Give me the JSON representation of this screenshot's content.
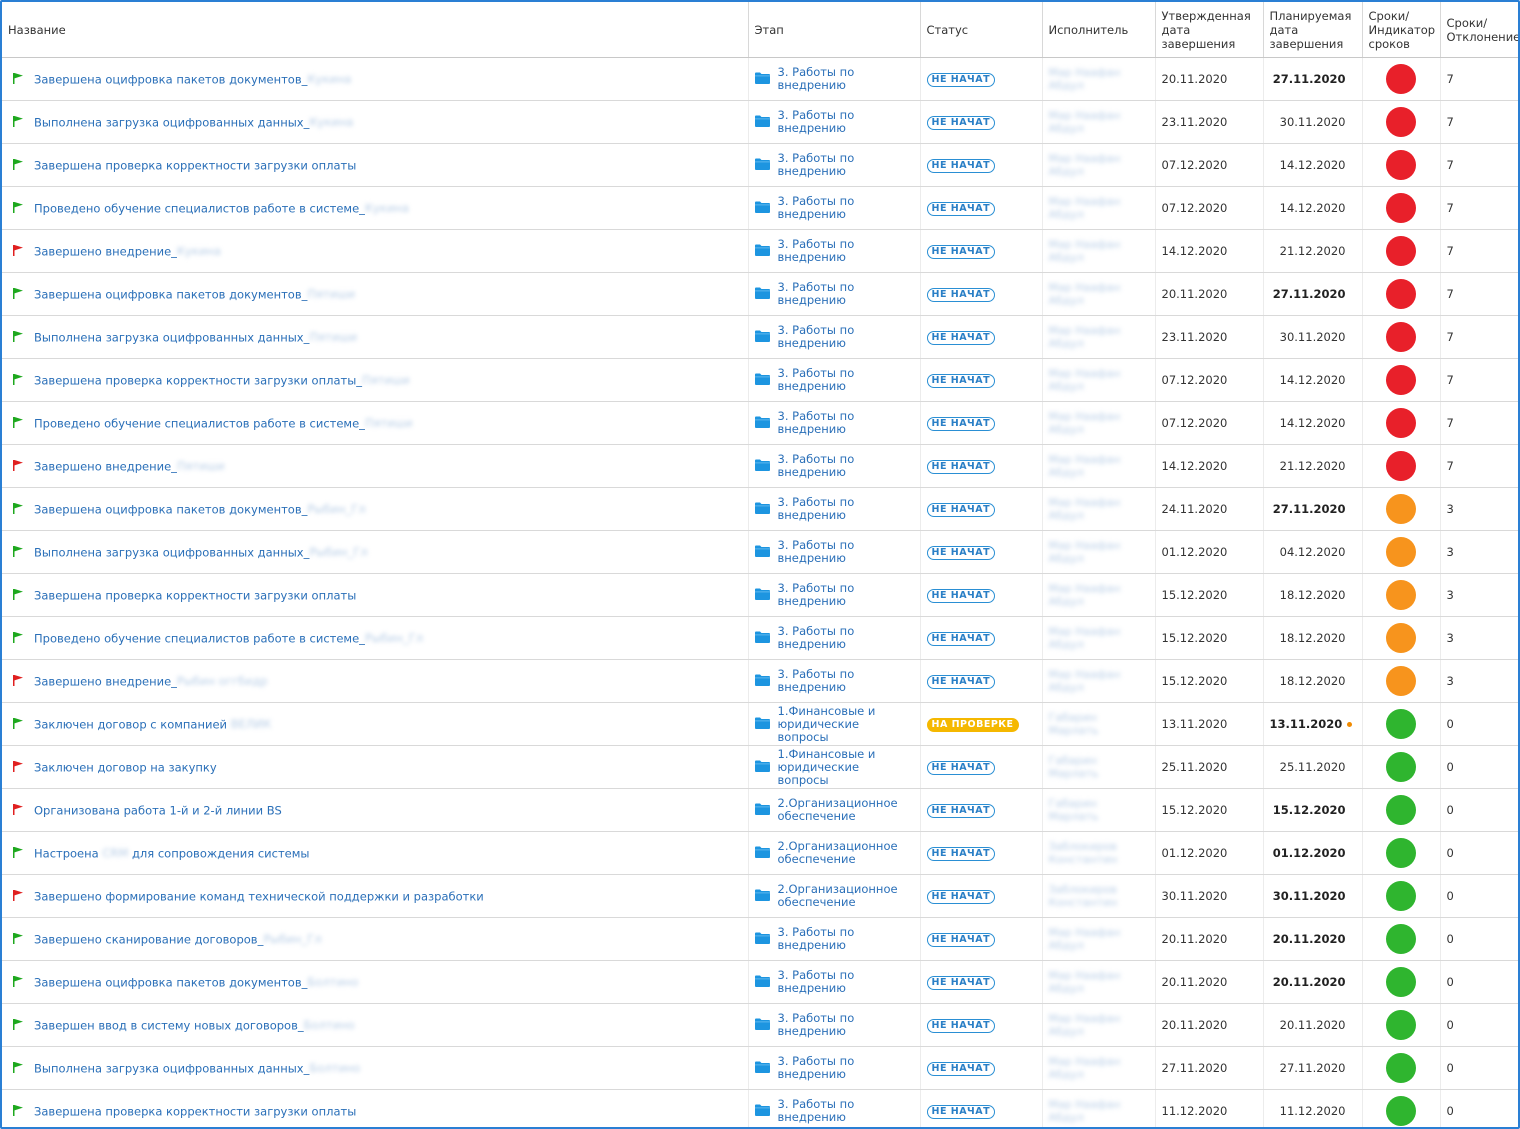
{
  "columns": {
    "name": "Название",
    "stage": "Этап",
    "status": "Статус",
    "executor": "Исполнитель",
    "approved_date": "Утвержденная дата завершения",
    "planned_date": "Планируемая дата завершения",
    "indicator": "Сроки/ Индикатор сроков",
    "deviation": "Сроки/ Отклонение"
  },
  "colors": {
    "red": "#e8202a",
    "orange": "#f7941d",
    "green": "#2fb52f",
    "flag_green": "#1ea81e",
    "flag_red": "#e02020",
    "link": "#2a6fb8",
    "accent": "#2a7fd4"
  },
  "rows": [
    {
      "flag": "green",
      "name": "Завершена оцифровка пакетов документов_",
      "suffix": "Кукина",
      "stage": "3. Работы по внедрению",
      "status": "НЕ НАЧАТ",
      "status_type": "new",
      "executor": "Мар Наафан Абдул",
      "approved": "20.11.2020",
      "planned": "27.11.2020",
      "planned_bold": true,
      "planned_dot": false,
      "indicator": "red",
      "deviation": "7"
    },
    {
      "flag": "green",
      "name": "Выполнена загрузка оцифрованных данных_",
      "suffix": "Кукина",
      "stage": "3. Работы по внедрению",
      "status": "НЕ НАЧАТ",
      "status_type": "new",
      "executor": "Мар Наафан Абдул",
      "approved": "23.11.2020",
      "planned": "30.11.2020",
      "planned_bold": false,
      "planned_dot": false,
      "indicator": "red",
      "deviation": "7"
    },
    {
      "flag": "green",
      "name": "Завершена проверка корректности загрузки оплаты",
      "suffix": "",
      "stage": "3. Работы по внедрению",
      "status": "НЕ НАЧАТ",
      "status_type": "new",
      "executor": "Мар Наафан Абдул",
      "approved": "07.12.2020",
      "planned": "14.12.2020",
      "planned_bold": false,
      "planned_dot": false,
      "indicator": "red",
      "deviation": "7"
    },
    {
      "flag": "green",
      "name": "Проведено обучение специалистов работе в системе_",
      "suffix": "Кукина",
      "stage": "3. Работы по внедрению",
      "status": "НЕ НАЧАТ",
      "status_type": "new",
      "executor": "Мар Наафан Абдул",
      "approved": "07.12.2020",
      "planned": "14.12.2020",
      "planned_bold": false,
      "planned_dot": false,
      "indicator": "red",
      "deviation": "7"
    },
    {
      "flag": "red",
      "name": "Завершено внедрение_",
      "suffix": "Кукина",
      "stage": "3. Работы по внедрению",
      "status": "НЕ НАЧАТ",
      "status_type": "new",
      "executor": "Мар Наафан Абдул",
      "approved": "14.12.2020",
      "planned": "21.12.2020",
      "planned_bold": false,
      "planned_dot": false,
      "indicator": "red",
      "deviation": "7"
    },
    {
      "flag": "green",
      "name": "Завершена оцифровка пакетов документов_",
      "suffix": "Пятиши",
      "stage": "3. Работы по внедрению",
      "status": "НЕ НАЧАТ",
      "status_type": "new",
      "executor": "Мар Наафан Абдул",
      "approved": "20.11.2020",
      "planned": "27.11.2020",
      "planned_bold": true,
      "planned_dot": false,
      "indicator": "red",
      "deviation": "7"
    },
    {
      "flag": "green",
      "name": "Выполнена загрузка оцифрованных данных_",
      "suffix": "Пятиши",
      "stage": "3. Работы по внедрению",
      "status": "НЕ НАЧАТ",
      "status_type": "new",
      "executor": "Мар Наафан Абдул",
      "approved": "23.11.2020",
      "planned": "30.11.2020",
      "planned_bold": false,
      "planned_dot": false,
      "indicator": "red",
      "deviation": "7"
    },
    {
      "flag": "green",
      "name": "Завершена проверка корректности загрузки оплаты_",
      "suffix": "Пятиши",
      "stage": "3. Работы по внедрению",
      "status": "НЕ НАЧАТ",
      "status_type": "new",
      "executor": "Мар Наафан Абдул",
      "approved": "07.12.2020",
      "planned": "14.12.2020",
      "planned_bold": false,
      "planned_dot": false,
      "indicator": "red",
      "deviation": "7"
    },
    {
      "flag": "green",
      "name": "Проведено обучение специалистов работе в системе_",
      "suffix": "Пятиши",
      "stage": "3. Работы по внедрению",
      "status": "НЕ НАЧАТ",
      "status_type": "new",
      "executor": "Мар Наафан Абдул",
      "approved": "07.12.2020",
      "planned": "14.12.2020",
      "planned_bold": false,
      "planned_dot": false,
      "indicator": "red",
      "deviation": "7"
    },
    {
      "flag": "red",
      "name": "Завершено внедрение_",
      "suffix": "Пятиши",
      "stage": "3. Работы по внедрению",
      "status": "НЕ НАЧАТ",
      "status_type": "new",
      "executor": "Мар Наафан Абдул",
      "approved": "14.12.2020",
      "planned": "21.12.2020",
      "planned_bold": false,
      "planned_dot": false,
      "indicator": "red",
      "deviation": "7"
    },
    {
      "flag": "green",
      "name": "Завершена оцифровка пакетов документов_",
      "suffix": "Рыбин_Гл",
      "stage": "3. Работы по внедрению",
      "status": "НЕ НАЧАТ",
      "status_type": "new",
      "executor": "Мар Наафан Абдул",
      "approved": "24.11.2020",
      "planned": "27.11.2020",
      "planned_bold": true,
      "planned_dot": false,
      "indicator": "orange",
      "deviation": "3"
    },
    {
      "flag": "green",
      "name": "Выполнена загрузка оцифрованных данных_",
      "suffix": "Рыбин_Гл",
      "stage": "3. Работы по внедрению",
      "status": "НЕ НАЧАТ",
      "status_type": "new",
      "executor": "Мар Наафан Абдул",
      "approved": "01.12.2020",
      "planned": "04.12.2020",
      "planned_bold": false,
      "planned_dot": false,
      "indicator": "orange",
      "deviation": "3"
    },
    {
      "flag": "green",
      "name": "Завершена проверка корректности загрузки оплаты",
      "suffix": "",
      "stage": "3. Работы по внедрению",
      "status": "НЕ НАЧАТ",
      "status_type": "new",
      "executor": "Мар Наафан Абдул",
      "approved": "15.12.2020",
      "planned": "18.12.2020",
      "planned_bold": false,
      "planned_dot": false,
      "indicator": "orange",
      "deviation": "3"
    },
    {
      "flag": "green",
      "name": "Проведено обучение специалистов работе в системе_",
      "suffix": "Рыбин_Гл",
      "stage": "3. Работы по внедрению",
      "status": "НЕ НАЧАТ",
      "status_type": "new",
      "executor": "Мар Наафан Абдул",
      "approved": "15.12.2020",
      "planned": "18.12.2020",
      "planned_bold": false,
      "planned_dot": false,
      "indicator": "orange",
      "deviation": "3"
    },
    {
      "flag": "red",
      "name": "Завершено внедрение_",
      "suffix": "Рыбин оггбидр",
      "stage": "3. Работы по внедрению",
      "status": "НЕ НАЧАТ",
      "status_type": "new",
      "executor": "Мар Наафан Абдул",
      "approved": "15.12.2020",
      "planned": "18.12.2020",
      "planned_bold": false,
      "planned_dot": false,
      "indicator": "orange",
      "deviation": "3"
    },
    {
      "flag": "green",
      "name": "Заключен договор с компанией ",
      "suffix": "ВЕЛИК",
      "stage": "1.Финансовые и юридические вопросы",
      "status": "НА ПРОВЕРКЕ",
      "status_type": "review",
      "executor": "Габарин Марлать",
      "approved": "13.11.2020",
      "planned": "13.11.2020",
      "planned_bold": true,
      "planned_dot": true,
      "indicator": "green",
      "deviation": "0"
    },
    {
      "flag": "red",
      "name": "Заключен договор на закупку",
      "suffix": "",
      "stage": "1.Финансовые и юридические вопросы",
      "status": "НЕ НАЧАТ",
      "status_type": "new",
      "executor": "Габарин Марлать",
      "approved": "25.11.2020",
      "planned": "25.11.2020",
      "planned_bold": false,
      "planned_dot": false,
      "indicator": "green",
      "deviation": "0"
    },
    {
      "flag": "red",
      "name": "Организована работа 1-й и 2-й линии BS",
      "suffix": "",
      "stage": "2.Организационное обеспечение",
      "status": "НЕ НАЧАТ",
      "status_type": "new",
      "executor": "Габарин Марлать",
      "approved": "15.12.2020",
      "planned": "15.12.2020",
      "planned_bold": true,
      "planned_dot": false,
      "indicator": "green",
      "deviation": "0"
    },
    {
      "flag": "green",
      "name": "Настроена ",
      "suffix": "CRM",
      "name_after": " для сопровождения системы",
      "stage": "2.Организационное обеспечение",
      "status": "НЕ НАЧАТ",
      "status_type": "new",
      "executor": "Заблокиров Константин",
      "approved": "01.12.2020",
      "planned": "01.12.2020",
      "planned_bold": true,
      "planned_dot": false,
      "indicator": "green",
      "deviation": "0"
    },
    {
      "flag": "red",
      "name": "Завершено формирование команд технической поддержки и разработки",
      "suffix": "",
      "stage": "2.Организационное обеспечение",
      "status": "НЕ НАЧАТ",
      "status_type": "new",
      "executor": "Заблокиров Константин",
      "approved": "30.11.2020",
      "planned": "30.11.2020",
      "planned_bold": true,
      "planned_dot": false,
      "indicator": "green",
      "deviation": "0"
    },
    {
      "flag": "green",
      "name": "Завершено сканирование договоров_",
      "suffix": "Рыбин_Гл",
      "stage": "3. Работы по внедрению",
      "status": "НЕ НАЧАТ",
      "status_type": "new",
      "executor": "Мар Наафан Абдул",
      "approved": "20.11.2020",
      "planned": "20.11.2020",
      "planned_bold": true,
      "planned_dot": false,
      "indicator": "green",
      "deviation": "0"
    },
    {
      "flag": "green",
      "name": "Завершена оцифровка пакетов документов_",
      "suffix": "Болтино",
      "stage": "3. Работы по внедрению",
      "status": "НЕ НАЧАТ",
      "status_type": "new",
      "executor": "Мар Наафан Абдул",
      "approved": "20.11.2020",
      "planned": "20.11.2020",
      "planned_bold": true,
      "planned_dot": false,
      "indicator": "green",
      "deviation": "0"
    },
    {
      "flag": "green",
      "name": "Завершен ввод в систему новых договоров_",
      "suffix": "Болтино",
      "stage": "3. Работы по внедрению",
      "status": "НЕ НАЧАТ",
      "status_type": "new",
      "executor": "Мар Наафан Абдул",
      "approved": "20.11.2020",
      "planned": "20.11.2020",
      "planned_bold": false,
      "planned_dot": false,
      "indicator": "green",
      "deviation": "0"
    },
    {
      "flag": "green",
      "name": "Выполнена загрузка оцифрованных данных_",
      "suffix": "Болтино",
      "stage": "3. Работы по внедрению",
      "status": "НЕ НАЧАТ",
      "status_type": "new",
      "executor": "Мар Наафан Абдул",
      "approved": "27.11.2020",
      "planned": "27.11.2020",
      "planned_bold": false,
      "planned_dot": false,
      "indicator": "green",
      "deviation": "0"
    },
    {
      "flag": "green",
      "name": "Завершена проверка корректности загрузки оплаты",
      "suffix": "",
      "stage": "3. Работы по внедрению",
      "status": "НЕ НАЧАТ",
      "status_type": "new",
      "executor": "Мар Наафан Абдул",
      "approved": "11.12.2020",
      "planned": "11.12.2020",
      "planned_bold": false,
      "planned_dot": false,
      "indicator": "green",
      "deviation": "0"
    }
  ]
}
